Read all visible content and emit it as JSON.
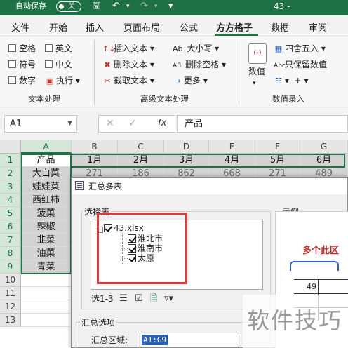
{
  "titlebar": {
    "autosave_label": "自动保存",
    "autosave_state": "关",
    "doc_title": "43 -"
  },
  "tabs": [
    "文件",
    "开始",
    "插入",
    "页面布局",
    "公式",
    "方方格子",
    "数据",
    "审阅"
  ],
  "active_tab": "方方格子",
  "ribbon": {
    "text_group": {
      "checks": [
        "空格",
        "英文",
        "符号",
        "中文",
        "数字"
      ],
      "execute_label": "执行",
      "label": "文本处理"
    },
    "advanced_group": {
      "items": [
        "插入文本",
        "删除文本",
        "截取文本"
      ],
      "case_items": [
        "大小写",
        "删除空格",
        "更多"
      ],
      "case_icons": [
        "Ab",
        "AB",
        "→"
      ],
      "label": "高级文本处理"
    },
    "number_group": {
      "value_label": "数值",
      "items": [
        "四舍五入",
        "只保留数值"
      ],
      "label": "数值录入"
    }
  },
  "formula_bar": {
    "name_box": "A1",
    "fx": "fx",
    "formula": "产品"
  },
  "sheet": {
    "columns": [
      "A",
      "B",
      "C",
      "D",
      "E",
      "F",
      "G"
    ],
    "rows": [
      "1",
      "2",
      "3",
      "4",
      "5",
      "6",
      "7",
      "8",
      "9",
      "10",
      "11",
      "12",
      "13"
    ],
    "header_row": [
      "产品",
      "1月",
      "2月",
      "3月",
      "4月",
      "5月",
      "6月"
    ],
    "products": [
      "大白菜",
      "娃娃菜",
      "西红柿",
      "菠菜",
      "辣椒",
      "韭菜",
      "油菜",
      "青菜"
    ],
    "partial_row2": [
      "271",
      "186",
      "862",
      "668",
      "271",
      "489"
    ]
  },
  "dialog": {
    "title": "汇总多表",
    "select_table_label": "选择表",
    "preview_label": "示例",
    "tree": {
      "root": "43.xlsx",
      "children": [
        "淮北市",
        "淮南市",
        "太原"
      ]
    },
    "selection_info": "选1-3",
    "preview_note": "多个此区",
    "preview_value": "49",
    "summary_options_label": "汇总选项",
    "range_label": "汇总区域:",
    "range_value": "A1:G9"
  },
  "watermark": "软件技巧",
  "colors": {
    "excel_green": "#1e7145",
    "highlight_red": "#e03a3a",
    "selection_blue": "#2a62b8"
  }
}
